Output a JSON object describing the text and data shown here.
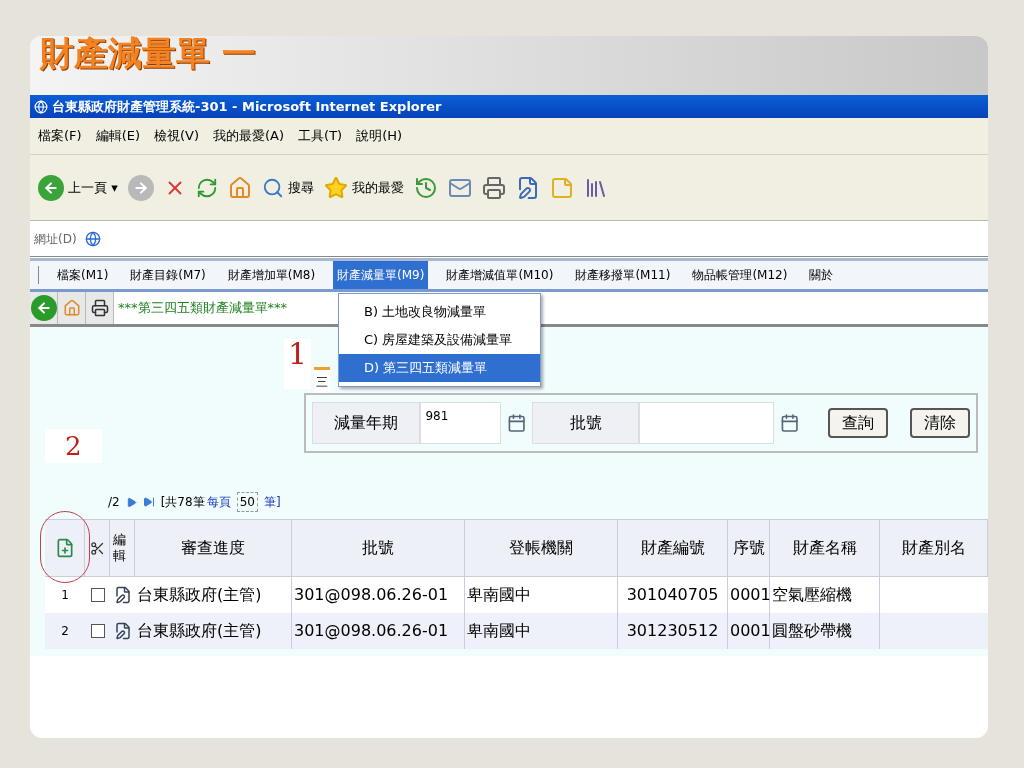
{
  "slide_title": "財產減量單 一",
  "window": {
    "title": "台東縣政府財產管理系統-301 - Microsoft Internet Explorer"
  },
  "menu_bar": [
    "檔案(F)",
    "編輯(E)",
    "檢視(V)",
    "我的最愛(A)",
    "工具(T)",
    "說明(H)"
  ],
  "toolbar": {
    "back": "上一頁",
    "back_caret": "▾",
    "search": "搜尋",
    "favorites": "我的最愛"
  },
  "address_bar": {
    "label": "網址(D)"
  },
  "app_menu": [
    {
      "label": "檔案(M1)",
      "selected": false
    },
    {
      "label": "財產目錄(M7)",
      "selected": false
    },
    {
      "label": "財產增加單(M8)",
      "selected": false
    },
    {
      "label": "財產減量單(M9)",
      "selected": true
    },
    {
      "label": "財產增減值單(M10)",
      "selected": false
    },
    {
      "label": "財產移撥單(M11)",
      "selected": false
    },
    {
      "label": "物品帳管理(M12)",
      "selected": false
    },
    {
      "label": "關於",
      "selected": false
    }
  ],
  "dropdown": [
    {
      "key": "B)",
      "label": "土地改良物減量單",
      "selected": false
    },
    {
      "key": "C)",
      "label": "房屋建築及設備減量單",
      "selected": false
    },
    {
      "key": "D)",
      "label": "第三四五類減量單",
      "selected": true
    }
  ],
  "page_title": "***第三四五類財產減量單***",
  "tab": {
    "label": "三"
  },
  "search_form": {
    "year_label": "減量年期",
    "year_value": "981",
    "batch_label": "批號",
    "buttons": [
      "查詢",
      "清除"
    ]
  },
  "pager": {
    "page": "/2",
    "total": "[共78筆",
    "per_page_label": "每頁",
    "per_page": "50",
    "unit": "筆]"
  },
  "table": {
    "columns": [
      "編輯",
      "審查進度",
      "批號",
      "登帳機關",
      "財產編號",
      "序號",
      "財產名稱",
      "財產別名"
    ],
    "rows": [
      {
        "no": "1",
        "checked": false,
        "progress": "台東縣政府(主管)",
        "batch": "301@098.06.26-01",
        "agency": "卑南國中",
        "property_no": "301040705",
        "seq": "0001",
        "name": "空氣壓縮機"
      },
      {
        "no": "2",
        "checked": false,
        "progress": "台東縣政府(主管)",
        "batch": "301@098.06.26-01",
        "agency": "卑南國中",
        "property_no": "301230512",
        "seq": "0001",
        "name": "圓盤砂帶機"
      }
    ]
  },
  "annotations": [
    "1",
    "2"
  ]
}
